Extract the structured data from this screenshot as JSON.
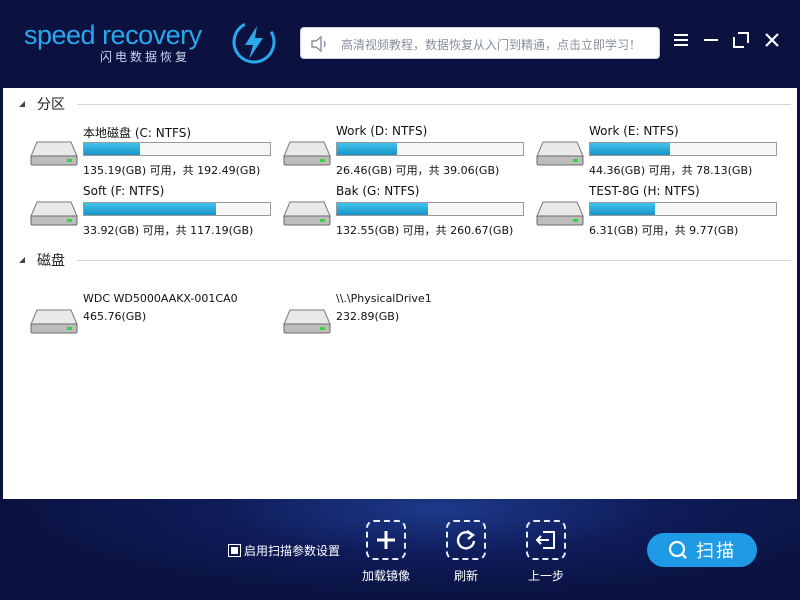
{
  "app": {
    "logo_text": "speed recovery",
    "logo_subtitle": "闪电数据恢复",
    "tip": "高清视频教程，数据恢复从入门到精通，点击立即学习！",
    "brand_color": "#2aa8ec"
  },
  "window_controls": {
    "menu_icon": "hamburger-icon",
    "minimize_icon": "minimize-icon",
    "maximize_icon": "maximize-icon",
    "close_icon": "close-icon"
  },
  "partitions": {
    "title": "分区",
    "items": [
      {
        "name": "本地磁盘 (C: NTFS)",
        "size_text": "135.19(GB) 可用，共 192.49(GB)",
        "used_fraction": 0.3
      },
      {
        "name": "Work (D: NTFS)",
        "size_text": "26.46(GB) 可用，共 39.06(GB)",
        "used_fraction": 0.32
      },
      {
        "name": "Work (E: NTFS)",
        "size_text": "44.36(GB) 可用，共 78.13(GB)",
        "used_fraction": 0.43
      },
      {
        "name": "Soft (F: NTFS)",
        "size_text": "33.92(GB) 可用，共 117.19(GB)",
        "used_fraction": 0.71
      },
      {
        "name": "Bak (G: NTFS)",
        "size_text": "132.55(GB) 可用，共 260.67(GB)",
        "used_fraction": 0.49
      },
      {
        "name": "TEST-8G (H: NTFS)",
        "size_text": "6.31(GB) 可用，共 9.77(GB)",
        "used_fraction": 0.35
      }
    ]
  },
  "disks": {
    "title": "磁盘",
    "items": [
      {
        "name": "WDC WD5000AAKX-001CA0",
        "size_text": "465.76(GB)"
      },
      {
        "name": "\\\\.\\PhysicalDrive1",
        "size_text": "232.89(GB)"
      }
    ]
  },
  "bottom": {
    "option_label": "启用扫描参数设置",
    "option_checked": true,
    "load_image_label": "加载镜像",
    "refresh_label": "刷新",
    "back_label": "上一步",
    "scan_label": "扫描"
  }
}
